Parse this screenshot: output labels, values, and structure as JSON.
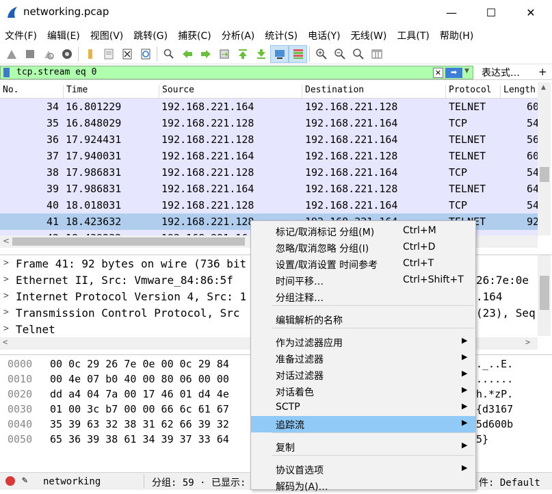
{
  "window": {
    "title": "networking.pcap",
    "minimize": "—",
    "maximize": "☐",
    "close": "✕"
  },
  "menu": [
    "文件(F)",
    "编辑(E)",
    "视图(V)",
    "跳转(G)",
    "捕获(C)",
    "分析(A)",
    "统计(S)",
    "电话(Y)",
    "无线(W)",
    "工具(T)",
    "帮助(H)"
  ],
  "toolbar_icons": [
    "start-capture-icon",
    "stop-capture-icon",
    "restart-capture-icon",
    "capture-options-icon",
    "open-file-icon",
    "save-file-icon",
    "close-file-icon",
    "reload-file-icon",
    "find-packet-icon",
    "go-back-icon",
    "go-forward-icon",
    "go-to-packet-icon",
    "first-packet-icon",
    "last-packet-icon",
    "auto-scroll-icon",
    "colorize-icon",
    "zoom-in-icon",
    "zoom-out-icon",
    "normal-size-icon",
    "resize-columns-icon"
  ],
  "filter": {
    "value": "tcp.stream eq 0",
    "expression_label": "表达式…",
    "plus": "+"
  },
  "packet_list": {
    "columns": [
      "No.",
      "Time",
      "Source",
      "Destination",
      "Protocol",
      "Length"
    ],
    "rows": [
      {
        "no": "34",
        "time": "16.801229",
        "src": "192.168.221.164",
        "dst": "192.168.221.128",
        "proto": "TELNET",
        "len": "60"
      },
      {
        "no": "35",
        "time": "16.848029",
        "src": "192.168.221.128",
        "dst": "192.168.221.164",
        "proto": "TCP",
        "len": "54"
      },
      {
        "no": "36",
        "time": "17.924431",
        "src": "192.168.221.128",
        "dst": "192.168.221.164",
        "proto": "TELNET",
        "len": "56"
      },
      {
        "no": "37",
        "time": "17.940031",
        "src": "192.168.221.164",
        "dst": "192.168.221.128",
        "proto": "TELNET",
        "len": "60"
      },
      {
        "no": "38",
        "time": "17.986831",
        "src": "192.168.221.128",
        "dst": "192.168.221.164",
        "proto": "TCP",
        "len": "54"
      },
      {
        "no": "39",
        "time": "17.986831",
        "src": "192.168.221.164",
        "dst": "192.168.221.128",
        "proto": "TELNET",
        "len": "64"
      },
      {
        "no": "40",
        "time": "18.018031",
        "src": "192.168.221.128",
        "dst": "192.168.221.164",
        "proto": "TCP",
        "len": "54"
      },
      {
        "no": "41",
        "time": "18.423632",
        "src": "192.168.221.128",
        "dst": "192.168.221.164",
        "proto": "TELNET",
        "len": "92"
      }
    ],
    "partial_row": {
      "no": "42",
      "time": "18.439232",
      "src": "192.168.221.164"
    }
  },
  "details": [
    {
      "left": "Frame 41: 92 bytes on wire (736 bit",
      "right": ""
    },
    {
      "left": "Ethernet II, Src: Vmware_84:86:5f",
      "right": "26:7e:0e"
    },
    {
      "left": "Internet Protocol Version 4, Src: 1",
      "right": ".164"
    },
    {
      "left": "Transmission Control Protocol, Src",
      "right": "(23), Seq"
    },
    {
      "left": "Telnet",
      "right": ""
    }
  ],
  "hex": [
    {
      "off": "0000",
      "bytes": "00 0c 29 26 7e 0e 00 0c  29 84",
      "ascii": "._..E."
    },
    {
      "off": "0010",
      "bytes": "00 4e 07 b0 40 00 80 06  00 00",
      "ascii": "......"
    },
    {
      "off": "0020",
      "bytes": "dd a4 04 7a 00 17 46 01  d4 4e",
      "ascii": "h.*zP."
    },
    {
      "off": "0030",
      "bytes": "01 00 3c b7 00 00 66 6c  61 67",
      "ascii": "{d3167"
    },
    {
      "off": "0040",
      "bytes": "35 39 63 32 38 31 62 66  39 32",
      "ascii": "5d600b"
    },
    {
      "off": "0050",
      "bytes": "65 36 39 38 61 34 39 37  33 64",
      "ascii": "5}"
    }
  ],
  "status": {
    "file": "networking",
    "packets": "分组: 59 · 已显示:",
    "profile": "件: Default"
  },
  "context_menu": {
    "items": [
      {
        "label": "标记/取消标记 分组(M)",
        "key": "Ctrl+M",
        "sub": false
      },
      {
        "label": "忽略/取消忽略 分组(I)",
        "key": "Ctrl+D",
        "sub": false
      },
      {
        "label": "设置/取消设置 时间参考",
        "key": "Ctrl+T",
        "sub": false
      },
      {
        "label": "时间平移…",
        "key": "Ctrl+Shift+T",
        "sub": false
      },
      {
        "label": "分组注释…",
        "key": "",
        "sub": false
      },
      {
        "label": "编辑解析的名称",
        "key": "",
        "sub": false
      },
      {
        "label": "作为过滤器应用",
        "key": "",
        "sub": true
      },
      {
        "label": "准备过滤器",
        "key": "",
        "sub": true
      },
      {
        "label": "对话过滤器",
        "key": "",
        "sub": true
      },
      {
        "label": "对话着色",
        "key": "",
        "sub": true
      },
      {
        "label": "SCTP",
        "key": "",
        "sub": true
      },
      {
        "label": "追踪流",
        "key": "",
        "sub": true
      },
      {
        "label": "复制",
        "key": "",
        "sub": true
      },
      {
        "label": "协议首选项",
        "key": "",
        "sub": true
      },
      {
        "label": "解码为(A)…",
        "key": "",
        "sub": false
      }
    ]
  },
  "colors": {
    "filter_bg": "#afffaf",
    "row_bg": "#e7e6ff",
    "row_selected": "#b0cdee",
    "menu_highlight": "#91c9f7"
  }
}
